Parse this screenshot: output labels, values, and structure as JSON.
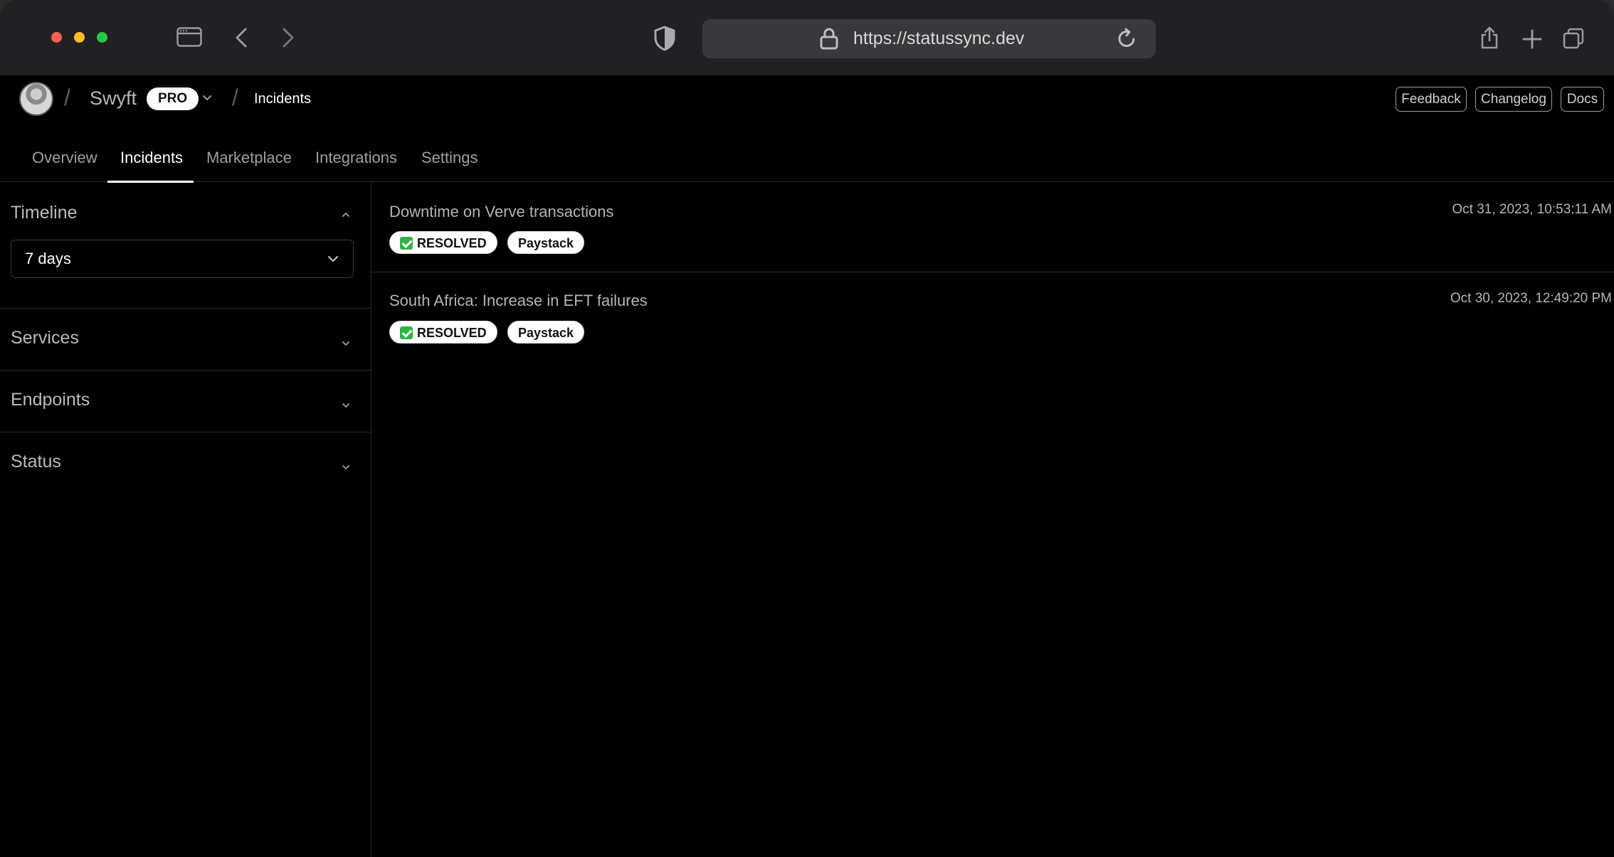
{
  "browser": {
    "url": "https://statussync.dev"
  },
  "header": {
    "org_name": "Swyft",
    "plan_badge": "PRO",
    "breadcrumb_current": "Incidents",
    "buttons": {
      "feedback": "Feedback",
      "changelog": "Changelog",
      "docs": "Docs"
    }
  },
  "tabs": [
    {
      "label": "Overview",
      "active": false
    },
    {
      "label": "Incidents",
      "active": true
    },
    {
      "label": "Marketplace",
      "active": false
    },
    {
      "label": "Integrations",
      "active": false
    },
    {
      "label": "Settings",
      "active": false
    }
  ],
  "sidebar": {
    "timeline": {
      "title": "Timeline",
      "expanded": true,
      "selected": "7 days"
    },
    "services": {
      "title": "Services",
      "expanded": false
    },
    "endpoints": {
      "title": "Endpoints",
      "expanded": false
    },
    "status": {
      "title": "Status",
      "expanded": false
    }
  },
  "incidents": [
    {
      "title": "Downtime on Verve transactions",
      "timestamp": "Oct 31, 2023, 10:53:11 AM",
      "status": "RESOLVED",
      "service": "Paystack"
    },
    {
      "title": "South Africa: Increase in EFT failures",
      "timestamp": "Oct 30, 2023, 12:49:20 PM",
      "status": "RESOLVED",
      "service": "Paystack"
    }
  ],
  "colors": {
    "background": "#000000",
    "chrome": "#212123",
    "resolved_check": "#2fb344"
  }
}
